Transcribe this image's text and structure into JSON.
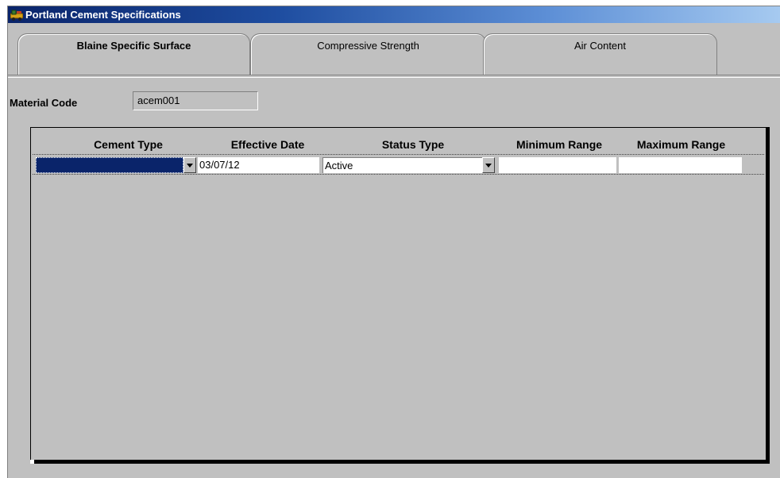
{
  "window": {
    "title": "Portland Cement Specifications"
  },
  "tabs": [
    {
      "label": "Blaine Specific Surface",
      "active": true
    },
    {
      "label": "Compressive Strength",
      "active": false
    },
    {
      "label": "Air Content",
      "active": false
    }
  ],
  "material": {
    "label": "Material Code",
    "value": "acem001"
  },
  "grid": {
    "columns": [
      "Cement Type",
      "Effective Date",
      "Status Type",
      "Minimum Range",
      "Maximum Range"
    ],
    "rows": [
      {
        "cement_type": "",
        "effective_date": "03/07/12",
        "status_type": "Active",
        "minimum_range": "",
        "maximum_range": ""
      }
    ]
  },
  "colors": {
    "selection": "#0a246a",
    "window_bg": "#c0c0c0",
    "title_start": "#0a246a",
    "title_end": "#a6caf0"
  }
}
